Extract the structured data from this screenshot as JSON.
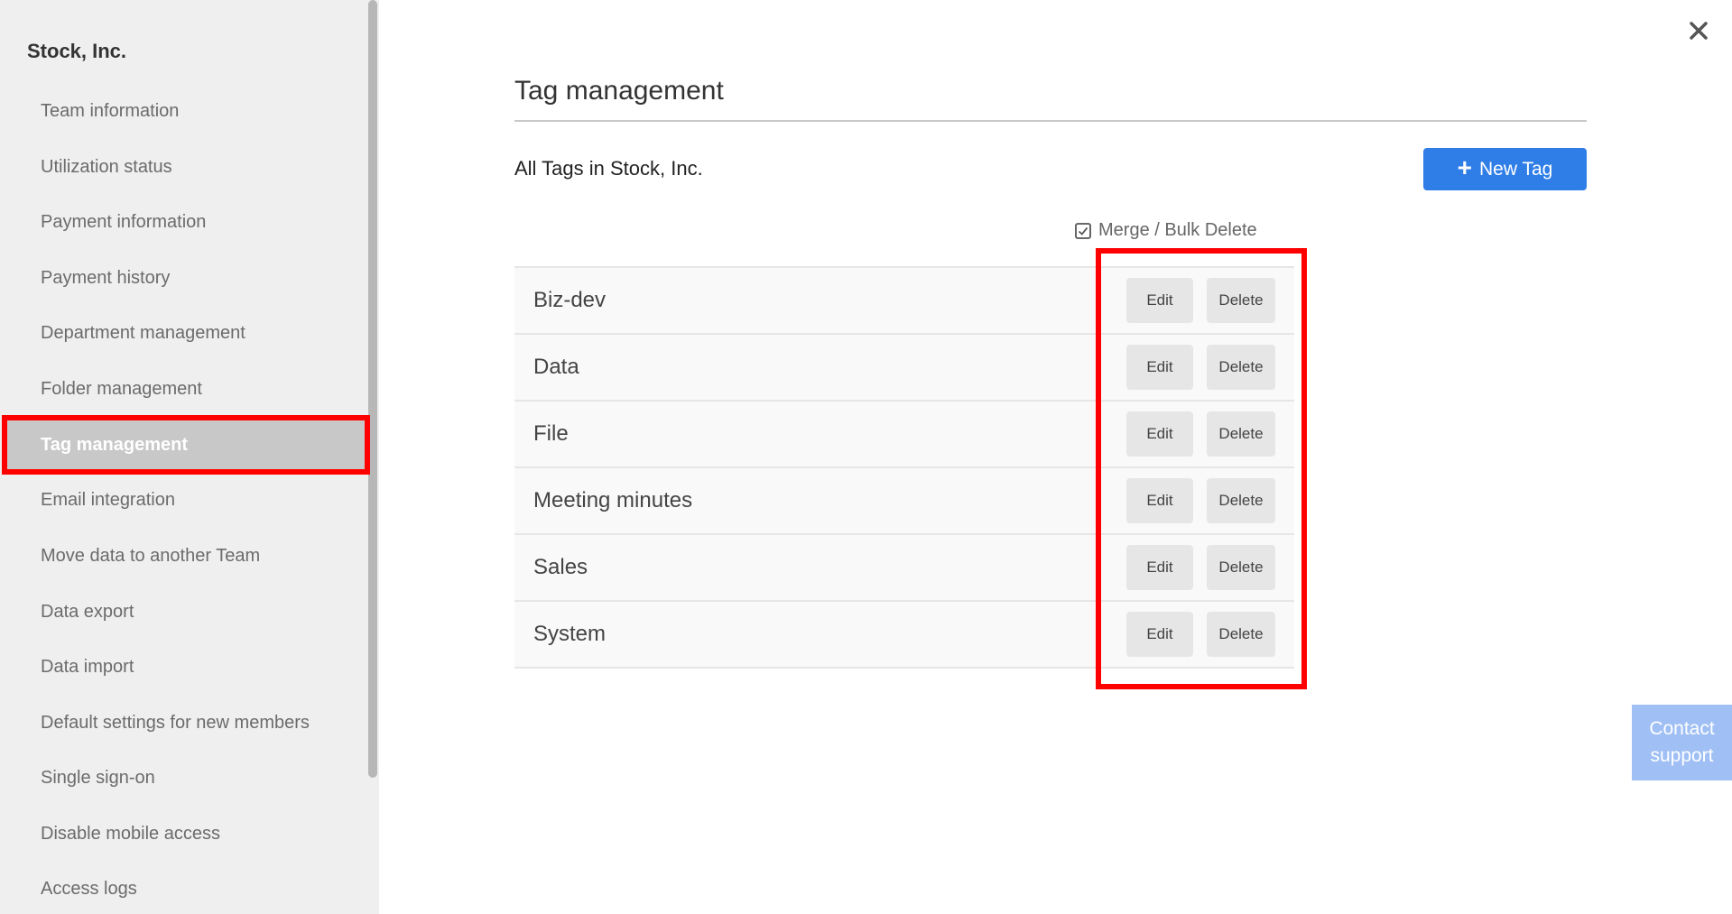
{
  "sidebar": {
    "team_name": "Stock, Inc.",
    "items": [
      {
        "label": "Team information"
      },
      {
        "label": "Utilization status"
      },
      {
        "label": "Payment information"
      },
      {
        "label": "Payment history"
      },
      {
        "label": "Department management"
      },
      {
        "label": "Folder management"
      },
      {
        "label": "Tag management",
        "active": true
      },
      {
        "label": "Email integration"
      },
      {
        "label": "Move data to another Team"
      },
      {
        "label": "Data export"
      },
      {
        "label": "Data import"
      },
      {
        "label": "Default settings for new members"
      },
      {
        "label": "Single sign-on"
      },
      {
        "label": "Disable mobile access"
      },
      {
        "label": "Access logs"
      }
    ]
  },
  "main": {
    "title": "Tag management",
    "subtitle": "All Tags in Stock, Inc.",
    "new_tag_label": "New Tag",
    "merge_label": "Merge / Bulk Delete",
    "edit_label": "Edit",
    "delete_label": "Delete",
    "tags": [
      "Biz-dev",
      "Data",
      "File",
      "Meeting minutes",
      "Sales",
      "System"
    ]
  },
  "contact_support": "Contact\nsupport",
  "colors": {
    "accent": "#2f7ee8",
    "highlight": "#ff0000",
    "sidebar_bg": "#efefef",
    "contact_bg": "#9fbff5"
  },
  "icons": {
    "close": "close-icon",
    "plus": "plus-icon",
    "checkbox": "checkbox-icon"
  }
}
